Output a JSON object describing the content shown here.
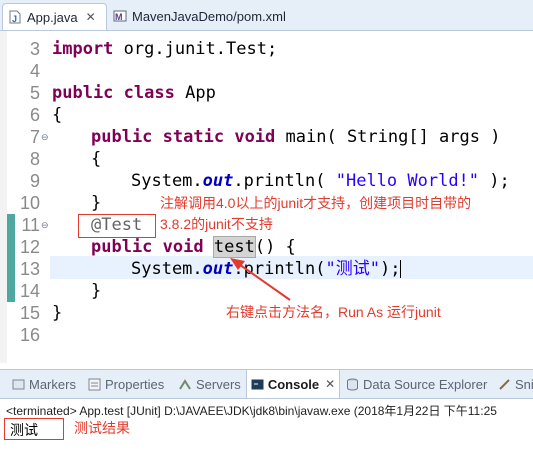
{
  "editor_tabs": [
    {
      "label": "App.java",
      "active": true,
      "icon": "java-file-icon"
    },
    {
      "label": "MavenJavaDemo/pom.xml",
      "active": false,
      "icon": "xml-file-icon"
    }
  ],
  "tab_close_glyph": "✕",
  "code_lines": [
    {
      "num": "3",
      "text": "import org.junit.Test;"
    },
    {
      "num": "4",
      "text": ""
    },
    {
      "num": "5",
      "text": "public class App"
    },
    {
      "num": "6",
      "text": "{"
    },
    {
      "num": "7",
      "text": "public static void main( String[] args )",
      "fold": "⊖"
    },
    {
      "num": "8",
      "text": "{"
    },
    {
      "num": "9",
      "text": "System.out.println( \"Hello World!\" );"
    },
    {
      "num": "10",
      "text": "}"
    },
    {
      "num": "11",
      "text": "@Test",
      "fold": "⊖"
    },
    {
      "num": "12",
      "text": "public void test() {"
    },
    {
      "num": "13",
      "text": "System.out.println(\"测试\");"
    },
    {
      "num": "14",
      "text": "}"
    },
    {
      "num": "15",
      "text": "}"
    },
    {
      "num": "16",
      "text": ""
    }
  ],
  "annotations": {
    "note1_line1": "注解调用4.0以上的junit才支持，创建项目时自带的",
    "note1_line2": "3.8.2的junit不支持",
    "note2": "右键点击方法名，Run As 运行junit",
    "note3": "测试结果"
  },
  "bottom_tabs": [
    {
      "label": "Markers",
      "icon": "markers-icon"
    },
    {
      "label": "Properties",
      "icon": "properties-icon"
    },
    {
      "label": "Servers",
      "icon": "servers-icon"
    },
    {
      "label": "Console",
      "icon": "console-icon",
      "active": true
    },
    {
      "label": "Data Source Explorer",
      "icon": "data-source-icon"
    },
    {
      "label": "Sni",
      "icon": "snippets-icon"
    }
  ],
  "console_close_glyph": "✕",
  "console": {
    "header": "<terminated> App.test [JUnit] D:\\JAVAEE\\JDK\\jdk8\\bin\\javaw.exe (2018年1月22日 下午11:25",
    "output": "测试"
  },
  "colors": {
    "annotation_red": "#e23b2e",
    "keyword": "#7f0055",
    "string": "#2a00ff"
  }
}
